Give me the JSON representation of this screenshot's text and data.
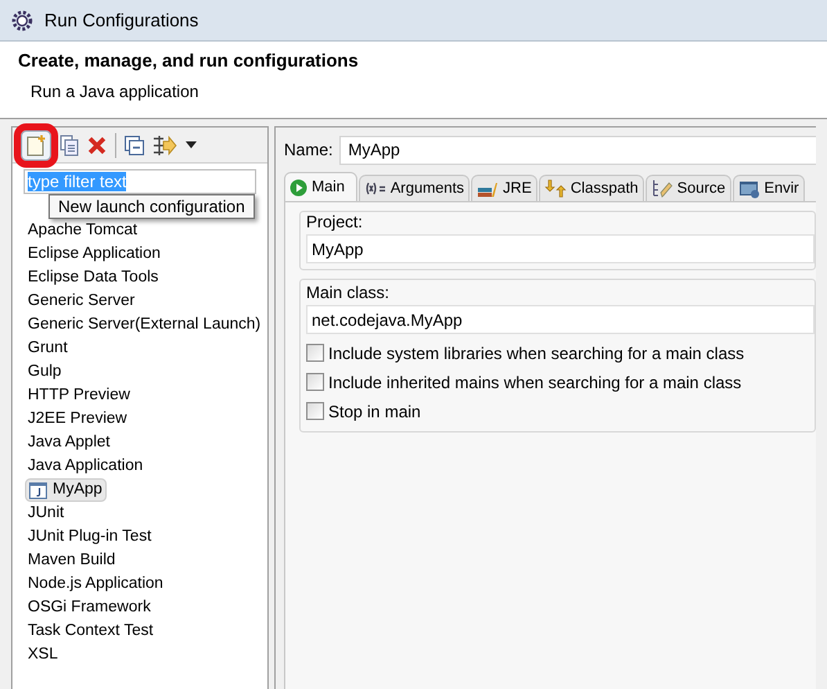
{
  "window": {
    "title": "Run Configurations"
  },
  "header": {
    "title": "Create, manage, and run configurations",
    "subtitle": "Run a Java application"
  },
  "toolbar": {
    "tooltip": "New launch configuration"
  },
  "filter": {
    "value": "type filter text",
    "selected": true
  },
  "tree": [
    {
      "label": "Apache Tomcat",
      "selected": false
    },
    {
      "label": "Eclipse Application",
      "selected": false
    },
    {
      "label": "Eclipse Data Tools",
      "selected": false
    },
    {
      "label": "Generic Server",
      "selected": false
    },
    {
      "label": "Generic Server(External Launch)",
      "selected": false
    },
    {
      "label": "Grunt",
      "selected": false
    },
    {
      "label": "Gulp",
      "selected": false
    },
    {
      "label": "HTTP Preview",
      "selected": false
    },
    {
      "label": "J2EE Preview",
      "selected": false
    },
    {
      "label": "Java Applet",
      "selected": false
    },
    {
      "label": "Java Application",
      "selected": false,
      "children": [
        {
          "label": "MyApp",
          "selected": true
        }
      ]
    },
    {
      "label": "JUnit",
      "selected": false
    },
    {
      "label": "JUnit Plug-in Test",
      "selected": false
    },
    {
      "label": "Maven Build",
      "selected": false
    },
    {
      "label": "Node.js Application",
      "selected": false
    },
    {
      "label": "OSGi Framework",
      "selected": false
    },
    {
      "label": "Task Context Test",
      "selected": false
    },
    {
      "label": "XSL",
      "selected": false
    }
  ],
  "name": {
    "label": "Name:",
    "value": "MyApp"
  },
  "tabs": [
    {
      "label": "Main",
      "kind": "main",
      "selected": true
    },
    {
      "label": "Arguments",
      "kind": "arguments",
      "selected": false
    },
    {
      "label": "JRE",
      "kind": "jre",
      "selected": false
    },
    {
      "label": "Classpath",
      "kind": "classpath",
      "selected": false
    },
    {
      "label": "Source",
      "kind": "source",
      "selected": false
    },
    {
      "label": "Envir",
      "kind": "environment",
      "selected": false
    }
  ],
  "project": {
    "label": "Project:",
    "value": "MyApp"
  },
  "main_class": {
    "label": "Main class:",
    "value": "net.codejava.MyApp"
  },
  "options": [
    {
      "label": "Include system libraries when searching for a main class",
      "checked": false
    },
    {
      "label": "Include inherited mains when searching for a main class",
      "checked": false
    },
    {
      "label": "Stop in main",
      "checked": false
    }
  ]
}
